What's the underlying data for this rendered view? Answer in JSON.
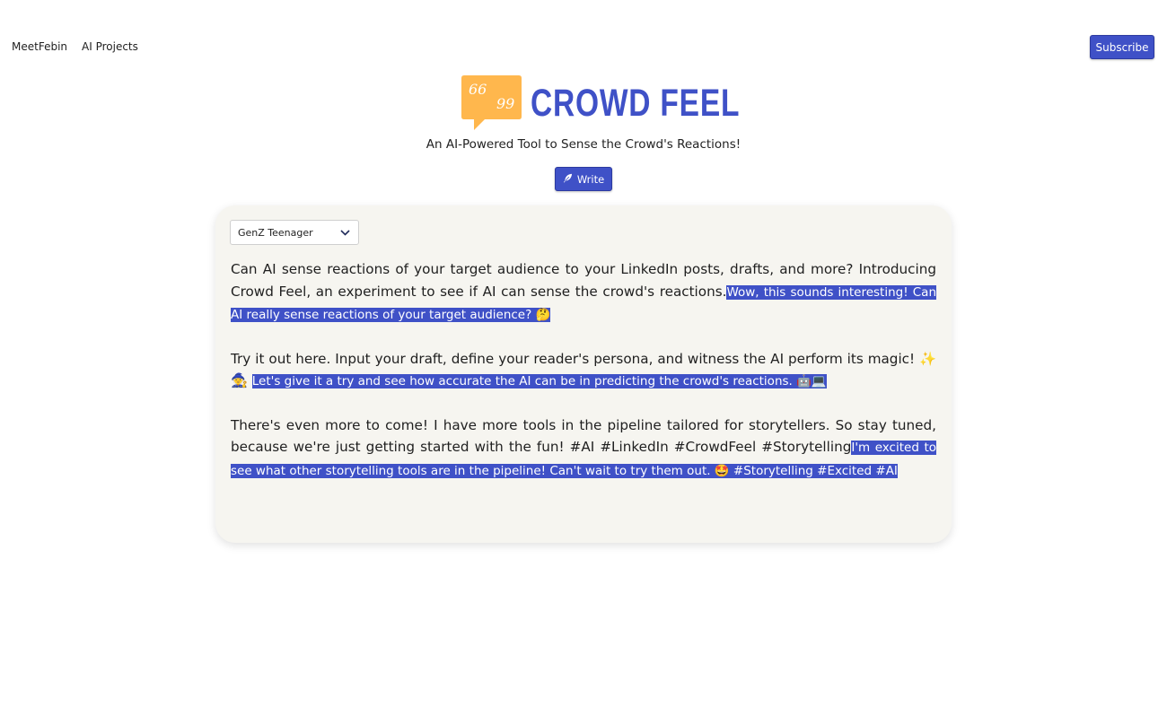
{
  "nav": {
    "items": [
      "MeetFebin",
      "AI Projects"
    ],
    "subscribe_label": "Subscribe"
  },
  "brand": {
    "name": "CROWD FEEL",
    "logo_quote_open": "66",
    "logo_quote_close": "99",
    "tagline": "An AI-Powered Tool to Sense the Crowd's Reactions!",
    "logo_color": "#ffb74d",
    "accent_color": "#3f51c7"
  },
  "write_button": {
    "icon": "feather-icon",
    "label": "Write"
  },
  "persona_select": {
    "value": "GenZ Teenager",
    "icon": "chevron-down-icon"
  },
  "post": {
    "paragraphs": [
      {
        "text": "Can AI sense reactions of your target audience to your LinkedIn posts, drafts, and more? Introducing Crowd Feel, an experiment to see if AI can sense the crowd's reactions.",
        "reaction": "Wow, this sounds interesting! Can AI really sense reactions of your target audience? 🤔"
      },
      {
        "text": "Try it out here. Input your draft, define your reader's persona, and witness the AI perform its magic! ✨🧙",
        "reaction": "Let's give it a try and see how accurate the AI can be in predicting the crowd's reactions. 🤖💻"
      },
      {
        "text": "There's even more to come! I have more tools in the pipeline tailored for storytellers. So stay tuned, because we're just getting started with the fun! #AI #LinkedIn #CrowdFeel #Storytelling",
        "reaction": "I'm excited to see what other storytelling tools are in the pipeline! Can't wait to try them out. 🤩 #Storytelling #Excited #AI"
      }
    ]
  }
}
